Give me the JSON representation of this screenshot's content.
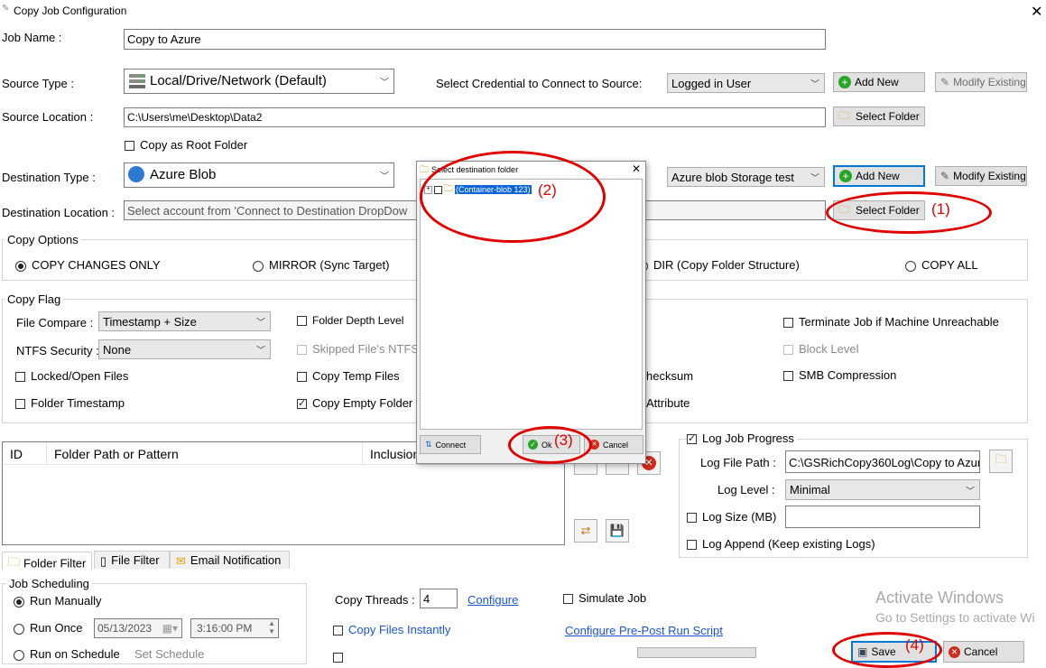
{
  "window": {
    "title": "Copy Job Configuration"
  },
  "job_name": {
    "label": "Job Name :",
    "value": "Copy to Azure"
  },
  "source": {
    "type_label": "Source Type :",
    "type_value": "Local/Drive/Network (Default)",
    "credential_label": "Select Credential to Connect to Source:",
    "credential_value": "Logged in User",
    "add_new": "Add New",
    "modify_existing": "Modify Existing",
    "location_label": "Source Location :",
    "location_value": "C:\\Users\\me\\Desktop\\Data2",
    "select_folder": "Select Folder",
    "copy_as_root": "Copy as Root Folder"
  },
  "destination": {
    "type_label": "Destination Type :",
    "type_value": "Azure Blob",
    "credential_value": "Azure blob Storage test",
    "add_new": "Add New",
    "modify_existing": "Modify Existing",
    "location_label": "Destination Location :",
    "location_placeholder": "Select account from 'Connect to Destination DropDow",
    "select_folder": "Select Folder"
  },
  "copy_options": {
    "title": "Copy Options",
    "copy_changes_only": "COPY CHANGES ONLY",
    "mirror": "MIRROR (Sync Target)",
    "dir": "DIR (Copy Folder Structure)",
    "copy_all": "COPY ALL"
  },
  "copy_flag": {
    "title": "Copy Flag",
    "file_compare_label": "File Compare :",
    "file_compare_value": "Timestamp + Size",
    "ntfs_label": "NTFS Security :",
    "ntfs_value": "None",
    "locked_open": "Locked/Open Files",
    "folder_timestamp": "Folder Timestamp",
    "folder_depth": "Folder Depth Level",
    "skipped_files": "Skipped File's NTFS",
    "copy_temp": "Copy Temp Files",
    "copy_empty": "Copy Empty Folder",
    "checksum": "hecksum",
    "attribute": "Attribute",
    "terminate": "Terminate Job if Machine Unreachable",
    "block_level": "Block Level",
    "smb": "SMB Compression"
  },
  "filter_table": {
    "col_id": "ID",
    "col_path": "Folder Path or Pattern",
    "col_inclusion": "Inclusion"
  },
  "log": {
    "progress": "Log Job Progress",
    "file_path_label": "Log File Path :",
    "file_path_value": "C:\\GSRichCopy360Log\\Copy to Azur",
    "level_label": "Log Level :",
    "level_value": "Minimal",
    "size": "Log Size (MB)",
    "append": "Log Append (Keep existing Logs)"
  },
  "tabs": {
    "folder_filter": "Folder Filter",
    "file_filter": "File Filter",
    "email": "Email Notification"
  },
  "scheduling": {
    "title": "Job Scheduling",
    "run_manually": "Run Manually",
    "run_once": "Run Once",
    "date": "05/13/2023",
    "time": "3:16:00 PM",
    "run_on_schedule": "Run on Schedule",
    "set_schedule": "Set Schedule"
  },
  "bottom": {
    "copy_threads_label": "Copy Threads :",
    "copy_threads_value": "4",
    "configure": "Configure",
    "simulate": "Simulate Job",
    "copy_instantly": "Copy Files Instantly",
    "pre_post": "Configure Pre-Post Run Script",
    "save": "Save",
    "cancel": "Cancel"
  },
  "watermark": {
    "line1": "Activate Windows",
    "line2": "Go to Settings to activate Wi"
  },
  "dialog": {
    "title": "Select destination folder",
    "tree_item": "(Container-blob 123)",
    "connect": "Connect",
    "ok": "Ok",
    "cancel": "Cancel"
  },
  "annotations": {
    "a1": "(1)",
    "a2": "(2)",
    "a3": "(3)",
    "a4": "(4)"
  }
}
